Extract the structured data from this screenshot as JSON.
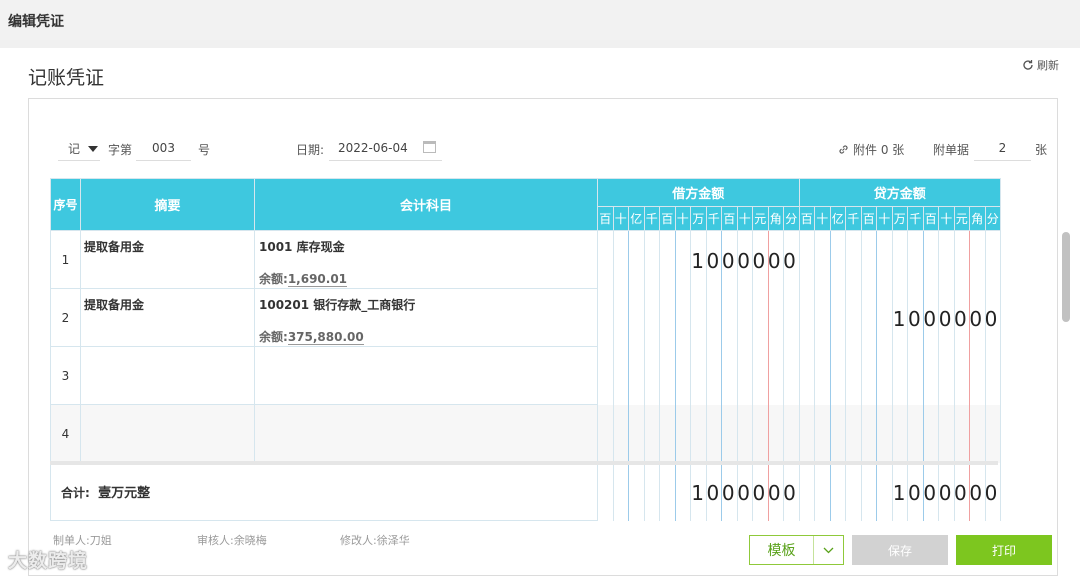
{
  "topbar": {
    "title": "编辑凭证"
  },
  "panel": {
    "title": "记账凭证",
    "refresh_label": "刷新"
  },
  "voucher_header": {
    "word": "记",
    "word_label": "字第",
    "number": "003",
    "number_suffix": "号",
    "date_label": "日期:",
    "date": "2022-06-04",
    "attachment_label": "附件 0 张",
    "receipts_label": "附单据",
    "receipts_count": "2",
    "receipts_unit": "张"
  },
  "table": {
    "headers": {
      "seq": "序号",
      "summary": "摘要",
      "account": "会计科目",
      "debit": "借方金额",
      "credit": "贷方金额"
    },
    "digit_units": [
      "百",
      "十",
      "亿",
      "千",
      "百",
      "十",
      "万",
      "千",
      "百",
      "十",
      "元",
      "角",
      "分"
    ],
    "rows": [
      {
        "seq": "1",
        "summary": "提取备用金",
        "account": "1001 库存现金",
        "balance_label": "余额:",
        "balance": "1,690.01",
        "debit": "1000000",
        "credit": ""
      },
      {
        "seq": "2",
        "summary": "提取备用金",
        "account": "100201 银行存款_工商银行",
        "balance_label": "余额:",
        "balance": "375,880.00",
        "debit": "",
        "credit": "1000000"
      },
      {
        "seq": "3",
        "summary": "",
        "account": "",
        "balance_label": "",
        "balance": "",
        "debit": "",
        "credit": ""
      },
      {
        "seq": "4",
        "summary": "",
        "account": "",
        "balance_label": "",
        "balance": "",
        "debit": "",
        "credit": ""
      }
    ],
    "total": {
      "label": "合计:",
      "amount_words": "壹万元整",
      "debit": "1000000",
      "credit": "1000000"
    }
  },
  "people": {
    "maker": "制单人:刀姐",
    "reviewer": "审核人:余晓梅",
    "modifier": "修改人:徐泽华"
  },
  "buttons": {
    "template": "模板",
    "save": "保存",
    "print": "打印"
  },
  "watermark": "大数跨境",
  "colors": {
    "header_bg": "#3ec8df",
    "primary_green": "#7dc61f",
    "disabled": "#d2d2d2",
    "yuan_line": "#f0a0a0",
    "digit_line": "#9ccbea"
  }
}
